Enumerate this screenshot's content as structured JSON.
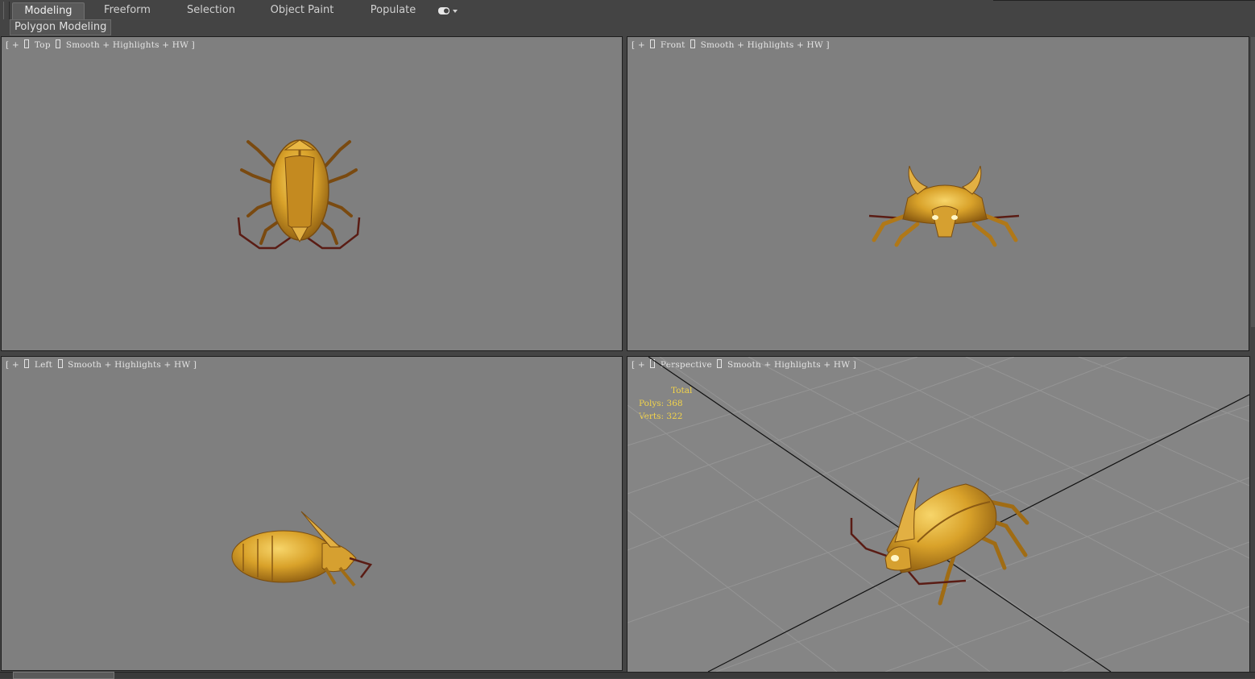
{
  "ribbon": {
    "tabs": [
      {
        "label": "Modeling",
        "active": true
      },
      {
        "label": "Freeform",
        "active": false
      },
      {
        "label": "Selection",
        "active": false
      },
      {
        "label": "Object Paint",
        "active": false
      },
      {
        "label": "Populate",
        "active": false
      }
    ],
    "extra_icon": "toggle-icon",
    "panel_label": "Polygon Modeling"
  },
  "viewports": {
    "top": {
      "bracket_open": "[ + ]",
      "view": "Top",
      "mode": "Smooth + Highlights + HW ]"
    },
    "front": {
      "bracket_open": "[ + ]",
      "view": "Front",
      "mode": "Smooth + Highlights + HW ]"
    },
    "left": {
      "bracket_open": "[ + ]",
      "view": "Left",
      "mode": "Smooth + Highlights + HW ]"
    },
    "persp": {
      "bracket_open": "[ + ]",
      "view": "Perspective",
      "mode": "Smooth + Highlights + HW ]"
    }
  },
  "stats": {
    "title": "Total",
    "polys": "Polys: 368",
    "verts": "Verts: 322"
  },
  "colors": {
    "viewport_bg": "#7f7f7f",
    "ui_bg": "#444444",
    "stats_text": "#f2d34a",
    "model_gold": "#d9a22a"
  }
}
